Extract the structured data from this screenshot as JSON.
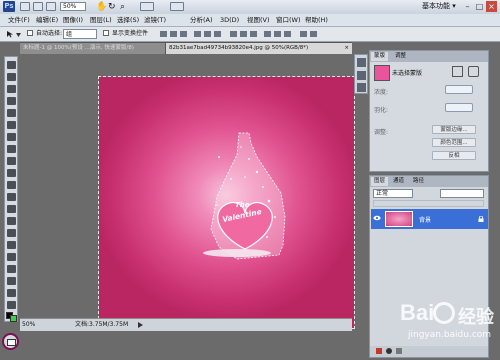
{
  "app": {
    "logo": "Ps",
    "zoom": "50%",
    "workspace": "基本功能 ▾"
  },
  "window_controls": {
    "minimize": "–",
    "maximize": "□",
    "close": "×"
  },
  "menu": [
    "文件(F)",
    "编辑(E)",
    "图像(I)",
    "图层(L)",
    "选择(S)",
    "滤镜(T)",
    "分析(A)",
    "3D(D)",
    "视图(V)",
    "窗口(W)",
    "帮助(H)"
  ],
  "options": {
    "auto_select_label": "自动选择:",
    "auto_select_value": "组",
    "transform_label": "显示变换控件"
  },
  "tabs": [
    {
      "label": "未标题-1 @ 100%(预设 ...演示, 快速蒙版/8)",
      "close": "×",
      "active": false
    },
    {
      "label": "82b31ae7bad49734b93820e4.jpg @ 50%(RGB/8*)",
      "close": "×",
      "active": true
    }
  ],
  "heart": {
    "line1": "The",
    "line2": "Valentine"
  },
  "status": {
    "zoom": "50%",
    "doc": "文档:3.75M/3.75M"
  },
  "adjustments_panel": {
    "tabs": [
      "蒙版",
      "调整"
    ],
    "title": "未选择蒙版",
    "density_label": "浓度:",
    "feather_label": "羽化:",
    "refine_label": "调整:",
    "buttons": [
      "蒙版边缘...",
      "颜色范围...",
      "反相"
    ]
  },
  "layers_panel": {
    "tabs": [
      "图层",
      "通道",
      "路径"
    ],
    "blend_mode": "正常",
    "layer_name": "背景"
  },
  "watermark": {
    "brand": "Bai",
    "brand2": "经验",
    "url": "jingyan.baidu.com"
  },
  "colors": {
    "canvas_center": "#f6c3da",
    "canvas_edge": "#b92662",
    "selection_blue": "#3a6fd8",
    "heart": "#f06aa1"
  }
}
